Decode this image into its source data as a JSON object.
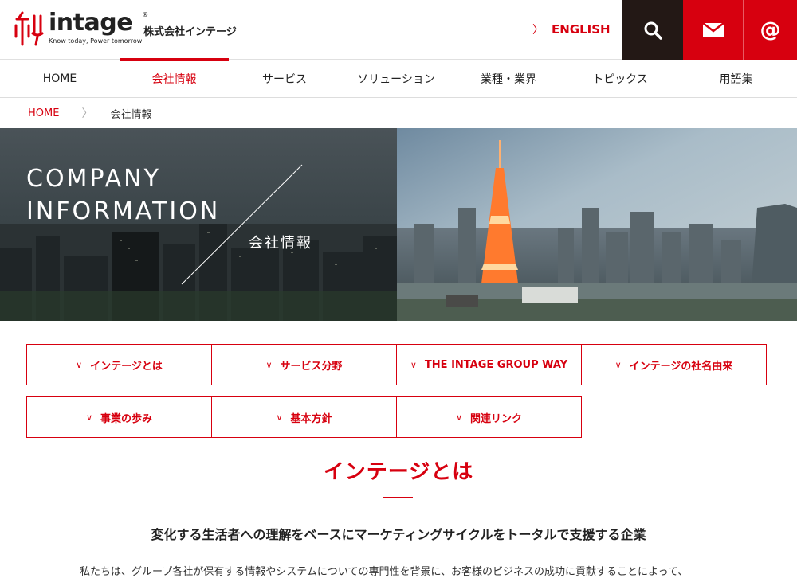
{
  "header": {
    "logo_word": "intage",
    "logo_reg": "®",
    "logo_tagline": "Know today, Power tomorrow",
    "corp_name": "株式会社インテージ",
    "english_label": "ENGLISH",
    "search_label": "",
    "mail_label": "",
    "at_label": "@"
  },
  "nav": {
    "items": [
      {
        "label": "HOME"
      },
      {
        "label": "会社情報"
      },
      {
        "label": "サービス"
      },
      {
        "label": "ソリューション"
      },
      {
        "label": "業種・業界"
      },
      {
        "label": "トピックス"
      },
      {
        "label": "用語集"
      }
    ]
  },
  "breadcrumb": {
    "home": "HOME",
    "current": "会社情報"
  },
  "hero": {
    "title_line1": "COMPANY",
    "title_line2": "INFORMATION",
    "subtitle": "会社情報"
  },
  "anchors": [
    {
      "label": "インテージとは"
    },
    {
      "label": "サービス分野"
    },
    {
      "label": "THE INTAGE GROUP WAY"
    },
    {
      "label": "インテージの社名由来"
    },
    {
      "label": "事業の歩み"
    },
    {
      "label": "基本方針"
    },
    {
      "label": "関連リンク"
    }
  ],
  "section": {
    "title": "インテージとは",
    "lead": "変化する生活者への理解をベースにマーケティングサイクルをトータルで支援する企業",
    "body": "私たちは、グループ各社が保有する情報やシステムについての専門性を背景に、お客様のビジネスの成功に貢献することによって、"
  },
  "colors": {
    "brand_red": "#d7000f",
    "dark": "#231815"
  }
}
